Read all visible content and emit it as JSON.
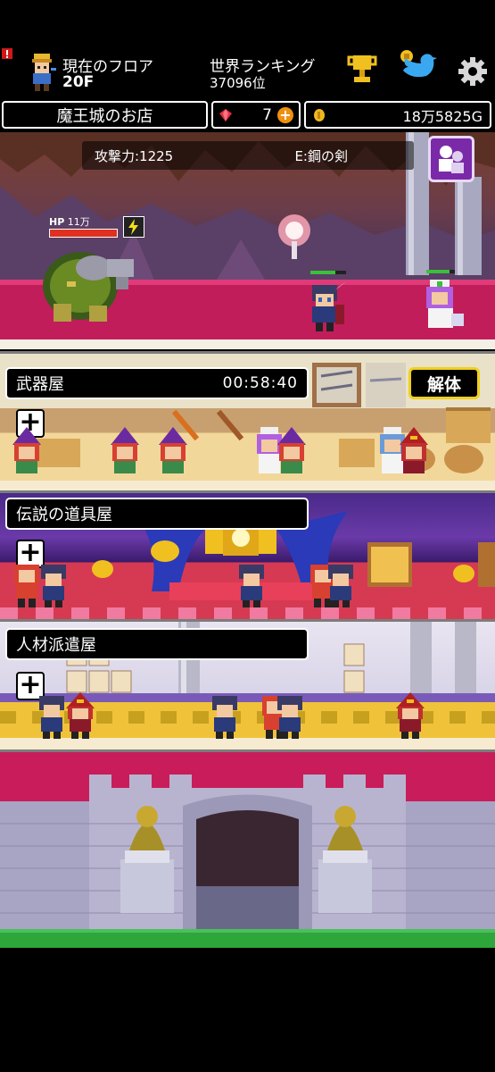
{
  "header": {
    "floor_label": "現在のフロア",
    "floor_value": "20F",
    "rank_label": "世界ランキング",
    "rank_value": "37096位"
  },
  "resources": {
    "shop_name": "魔王城のお店",
    "gems": "7",
    "gold": "18万5825G"
  },
  "battle": {
    "attack": "攻撃力:1225",
    "equipment": "E:鋼の剣",
    "enemy_hp_label": "HP",
    "enemy_hp_value": "11万"
  },
  "shops": [
    {
      "name": "武器屋",
      "timer": "00:58:40",
      "action": "解体"
    },
    {
      "name": "伝説の道具屋"
    },
    {
      "name": "人材派遣屋"
    }
  ],
  "colors": {
    "battle_floor": "#c11d5b",
    "weapon_shop_floor": "#f2d79a",
    "legend_shop_floor": "#d63a52",
    "staff_shop_floor": "#f0c23a",
    "castle_wall": "#b8b4d0",
    "grass": "#2da63a",
    "dismantle_border": "#f0d020"
  }
}
